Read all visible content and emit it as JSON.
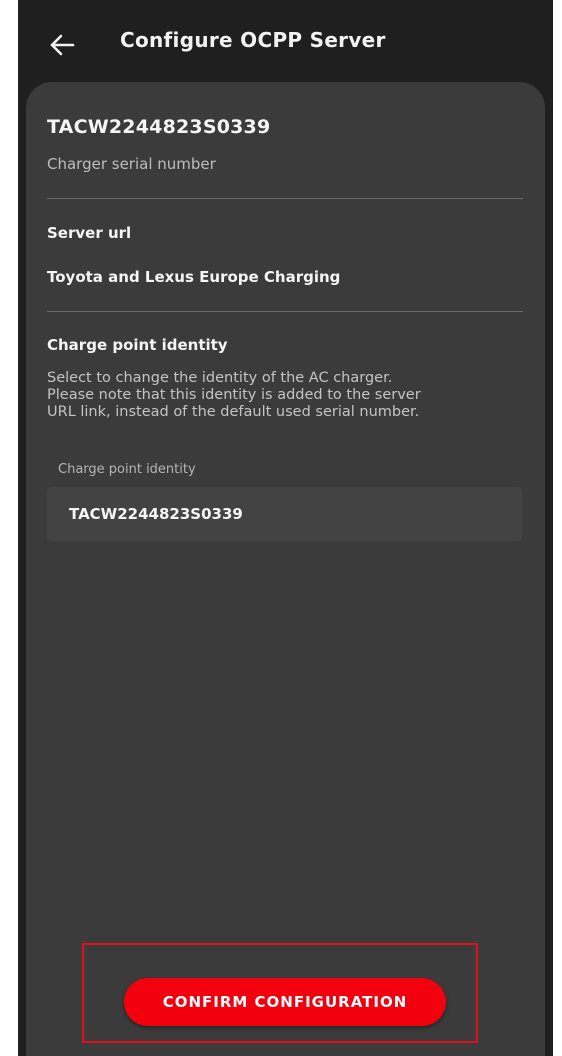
{
  "header": {
    "title": "Configure OCPP Server",
    "back_icon": "arrow-left-icon"
  },
  "charger": {
    "serial_number": "TACW2244823S0339",
    "serial_label": "Charger serial number"
  },
  "server_url": {
    "heading": "Server url",
    "value": "Toyota and Lexus Europe Charging"
  },
  "charge_point": {
    "heading": "Charge point identity",
    "description_lines": [
      "Select to change the identity of the AC charger.",
      "Please note that this identity is added to the server",
      "URL link, instead of the default used serial number."
    ],
    "field_label": "Charge point identity",
    "field_value": "TACW2244823S0339"
  },
  "actions": {
    "confirm_label": "CONFIRM CONFIGURATION"
  },
  "colors": {
    "background": "#1f1f1f",
    "card": "#3b3b3b",
    "accent": "#f2000d",
    "highlight": "#e0101a"
  }
}
